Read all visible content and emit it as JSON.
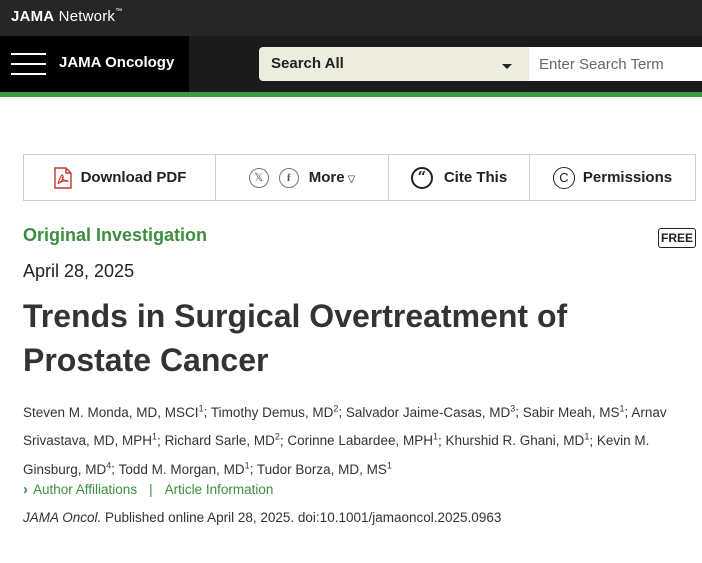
{
  "network": {
    "brand_bold": "JAMA",
    "brand_rest": " Network",
    "tm": "™"
  },
  "journal": {
    "name": "JAMA Oncology"
  },
  "search": {
    "scope": "Search All",
    "placeholder": "Enter Search Term"
  },
  "toolbar": {
    "download": "Download PDF",
    "more": "More",
    "cite": "Cite This",
    "permissions": "Permissions"
  },
  "article": {
    "type": "Original Investigation",
    "badge": "FREE",
    "date": "April 28, 2025",
    "title": "Trends in Surgical Overtreatment of Prostate Cancer",
    "authors": [
      {
        "name": "Steven M. Monda, MD, MSCI",
        "aff": "1"
      },
      {
        "name": "Timothy Demus, MD",
        "aff": "2"
      },
      {
        "name": "Salvador Jaime-Casas, MD",
        "aff": "3"
      },
      {
        "name": "Sabir Meah, MS",
        "aff": "1"
      },
      {
        "name": "Arnav Srivastava, MD, MPH",
        "aff": "1"
      },
      {
        "name": "Richard Sarle, MD",
        "aff": "2"
      },
      {
        "name": "Corinne Labardee, MPH",
        "aff": "1"
      },
      {
        "name": "Khurshid R. Ghani, MD",
        "aff": "1"
      },
      {
        "name": "Kevin M. Ginsburg, MD",
        "aff": "4"
      },
      {
        "name": "Todd M. Morgan, MD",
        "aff": "1"
      },
      {
        "name": "Tudor Borza, MD, MS",
        "aff": "1"
      }
    ],
    "affiliations_link": "Author Affiliations",
    "separator": "|",
    "info_link": "Article Information",
    "journal_abbrev": "JAMA Oncol.",
    "publication": " Published online April 28, 2025. doi:10.1001/jamaoncol.2025.0963"
  },
  "colors": {
    "accent_green": "#3b8e3f",
    "header_dark": "#1b1b1b",
    "search_bg": "#ececdf"
  },
  "icons": [
    "menu-icon",
    "pdf-icon",
    "x-icon",
    "facebook-icon",
    "caret-down-icon",
    "quote-icon",
    "copyright-icon",
    "chevron-right-icon"
  ]
}
